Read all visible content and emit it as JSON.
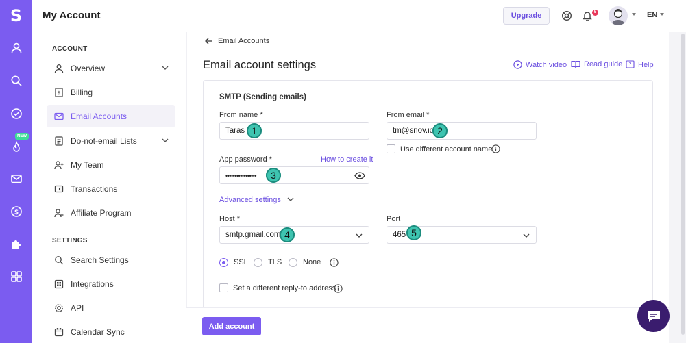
{
  "header": {
    "title": "My Account",
    "upgrade_label": "Upgrade",
    "notification_count": "5",
    "language": "EN"
  },
  "rail": {
    "logo": "S",
    "new_badge": "NEW",
    "icons": [
      "user-icon",
      "search-icon",
      "check-circle-icon",
      "flame-icon",
      "mail-icon",
      "dollar-icon",
      "puzzle-icon",
      "grid-icon"
    ]
  },
  "sidebar": {
    "account_title": "ACCOUNT",
    "settings_title": "SETTINGS",
    "account_items": [
      {
        "label": "Overview"
      },
      {
        "label": "Billing"
      },
      {
        "label": "Email Accounts"
      },
      {
        "label": "Do-not-email Lists"
      },
      {
        "label": "My Team"
      },
      {
        "label": "Transactions"
      },
      {
        "label": "Affiliate Program"
      }
    ],
    "settings_items": [
      {
        "label": "Search Settings"
      },
      {
        "label": "Integrations"
      },
      {
        "label": "API"
      },
      {
        "label": "Calendar Sync"
      }
    ]
  },
  "main": {
    "back_label": "Email Accounts",
    "title": "Email account settings",
    "watch_video": "Watch video",
    "read_guide": "Read guide",
    "help": "Help",
    "section_title": "SMTP (Sending emails)",
    "from_name_label": "From name",
    "from_name_value": "Taras",
    "from_email_label": "From email",
    "from_email_value": "tm@snov.io",
    "use_different_name": "Use different account name",
    "app_password_label": "App password",
    "how_to_create": "How to create it",
    "app_password_value": "•••••••••••••••••",
    "advanced_settings": "Advanced settings",
    "host_label": "Host",
    "host_value": "smtp.gmail.com",
    "port_label": "Port",
    "port_value": "465",
    "ssl": "SSL",
    "tls": "TLS",
    "none": "None",
    "reply_to": "Set a different reply-to address",
    "required_mark": "*",
    "markers": [
      "1",
      "2",
      "3",
      "4",
      "5"
    ],
    "add_account": "Add account"
  },
  "colors": {
    "accent": "#7b5cf0",
    "marker": "#3ec4b0",
    "badge": "#e8385a"
  }
}
